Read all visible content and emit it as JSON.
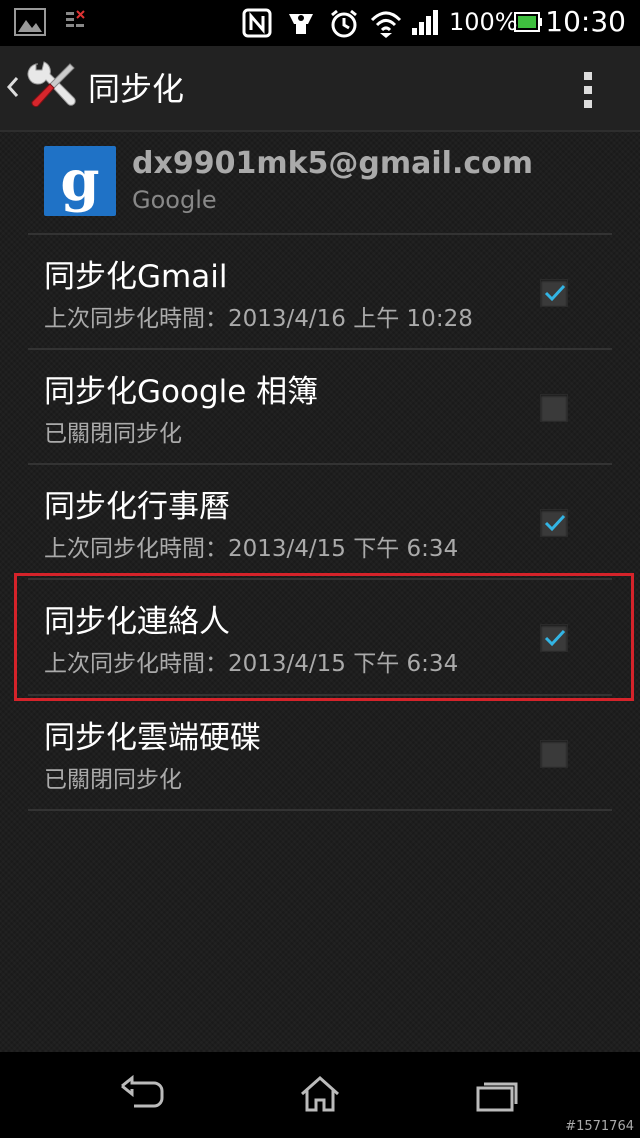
{
  "status_bar": {
    "battery_percent": "100%",
    "time": "10:30"
  },
  "action_bar": {
    "title": "同步化"
  },
  "account": {
    "email": "dx9901mk5@gmail.com",
    "type": "Google"
  },
  "sync_items": [
    {
      "title": "同步化Gmail",
      "subtitle": "上次同步化時間：2013/4/16 上午 10:28",
      "checked": true
    },
    {
      "title": "同步化Google 相簿",
      "subtitle": "已關閉同步化",
      "checked": false
    },
    {
      "title": "同步化行事曆",
      "subtitle": "上次同步化時間：2013/4/15 下午 6:34",
      "checked": true
    },
    {
      "title": "同步化連絡人",
      "subtitle": "上次同步化時間：2013/4/15 下午 6:34",
      "checked": true
    },
    {
      "title": "同步化雲端硬碟",
      "subtitle": "已關閉同步化",
      "checked": false
    }
  ],
  "watermark": "#1571764",
  "colors": {
    "accent": "#33b5e5",
    "highlight": "#d5232a",
    "google_blue": "#1f72c6"
  }
}
